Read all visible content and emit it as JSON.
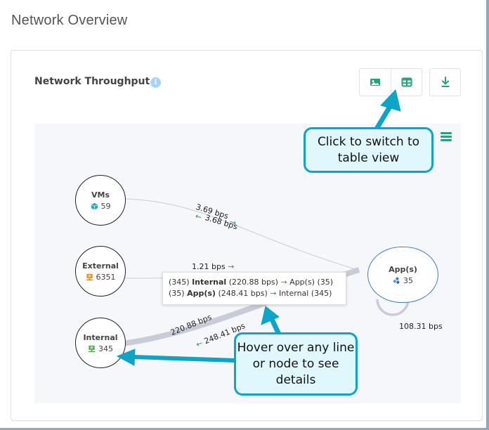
{
  "page": {
    "title": "Network Overview"
  },
  "card": {
    "title": "Network Throughput",
    "info_icon": "info-icon",
    "toolbar": {
      "buttons": [
        {
          "name": "image-view-button",
          "icon": "image-icon"
        },
        {
          "name": "table-view-button",
          "icon": "table-icon"
        },
        {
          "name": "download-button",
          "icon": "download-icon"
        }
      ]
    },
    "chart_menu_icon": "hamburger-menu-icon"
  },
  "colors": {
    "accent_green": "#21a67a",
    "callout_border": "#0aa5c8",
    "callout_fill": "#e0f7fd",
    "apps_border": "#3b7fcf",
    "flow_arrow": "#2ea043"
  },
  "graph": {
    "nodes": [
      {
        "id": "vms",
        "name": "VMs",
        "count": "59",
        "icon": "cube-icon"
      },
      {
        "id": "external",
        "name": "External",
        "count": "6351",
        "icon": "ip-icon"
      },
      {
        "id": "internal",
        "name": "Internal",
        "count": "345",
        "icon": "ip-icon"
      },
      {
        "id": "apps",
        "name": "App(s)",
        "count": "35",
        "icon": "apps-icon"
      }
    ],
    "edges": [
      {
        "from": "vms",
        "to": "apps",
        "forward": "3.69 bps",
        "reverse": "3.68 bps"
      },
      {
        "from": "external",
        "to": "apps",
        "forward": "1.21 bps"
      },
      {
        "from": "internal",
        "to": "apps",
        "forward": "220.88 bps",
        "reverse": "248.41 bps"
      },
      {
        "from": "apps",
        "to": "apps",
        "forward": "108.31 bps"
      }
    ],
    "arrow_right": "→",
    "arrow_left": "←"
  },
  "tooltip": {
    "row1": {
      "src_count": "(345)",
      "src": "Internal",
      "rate": "(220.88 bps)",
      "arrow": "→",
      "dst": "App(s) (35)"
    },
    "row2": {
      "src_count": "(35)",
      "src": "App(s)",
      "rate": "(248.41 bps)",
      "arrow": "→",
      "dst": "Internal (345)"
    }
  },
  "callouts": {
    "table_view": "Click to switch to table view",
    "hover": "Hover over any line or node to see details"
  }
}
